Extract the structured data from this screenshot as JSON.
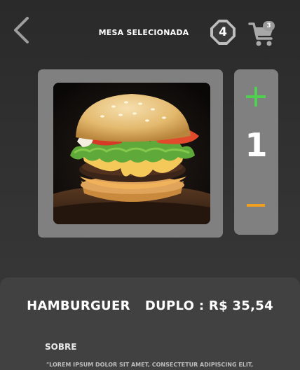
{
  "header": {
    "title": "MESA SELECIONADA",
    "table_number": "4",
    "cart_count": "3",
    "back_icon": "chevron-left-icon",
    "table_icon": "table-badge-icon",
    "cart_icon": "shopping-cart-icon"
  },
  "product": {
    "image_alt": "hamburger-photo",
    "name": "HAMBURGUER  DUPLO",
    "separator": ":",
    "price": "R$ 35,54"
  },
  "quantity": {
    "value": "1",
    "plus_icon": "plus-icon",
    "minus_icon": "minus-icon",
    "plus_color": "#4fd14f",
    "minus_color": "#f0a020"
  },
  "about": {
    "label": "SOBRE",
    "description": "\"LOREM IPSUM DOLOR SIT AMET, CONSECTETUR ADIPISCING ELIT,"
  },
  "colors": {
    "background": "#2f2f2f",
    "card": "#808080",
    "panel": "#414141",
    "text": "#ffffff"
  }
}
